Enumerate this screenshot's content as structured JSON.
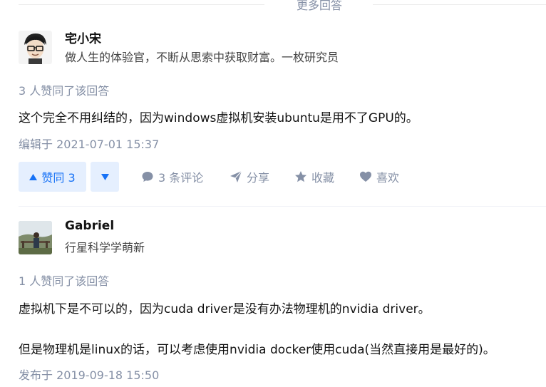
{
  "more_answers_label": "更多回答",
  "answers": [
    {
      "author_name": "宅小宋",
      "author_bio": "做人生的体验官，不断从思索中获取财富。一枚研究员",
      "votes_text": "3 人赞同了该回答",
      "content": [
        "这个完全不用纠结的，因为windows虚拟机安装ubuntu是用不了GPU的。"
      ],
      "time_text": "编辑于 2021-07-01 15:37",
      "actions": {
        "upvote_label": "赞同 3",
        "comments_label": "3 条评论",
        "share_label": "分享",
        "favorite_label": "收藏",
        "like_label": "喜欢"
      }
    },
    {
      "author_name": "Gabriel",
      "author_bio": "行星科学学萌新",
      "votes_text": "1 人赞同了该回答",
      "content": [
        "虚拟机下是不可以的，因为cuda driver是没有办法物理机的nvidia driver。",
        "但是物理机是linux的话，可以考虑使用nvidia docker使用cuda(当然直接用是最好的)。"
      ],
      "time_text": "发布于 2019-09-18 15:50"
    }
  ],
  "colors": {
    "accent": "#1772f6",
    "accent_bg": "#e5effe",
    "muted": "#8590a6"
  }
}
